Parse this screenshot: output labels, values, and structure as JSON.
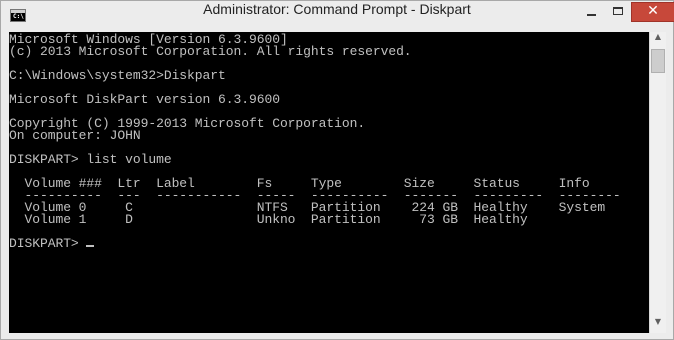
{
  "window": {
    "title": "Administrator: Command Prompt - Diskpart",
    "icon_label": "C:\\",
    "controls": {
      "minimize_icon": "minimize-icon",
      "maximize_icon": "maximize-icon",
      "close_glyph": "✕"
    }
  },
  "console": {
    "lines": [
      "Microsoft Windows [Version 6.3.9600]",
      "(c) 2013 Microsoft Corporation. All rights reserved.",
      "",
      "C:\\Windows\\system32>Diskpart",
      "",
      "Microsoft DiskPart version 6.3.9600",
      "",
      "Copyright (C) 1999-2013 Microsoft Corporation.",
      "On computer: JOHN",
      "",
      "DISKPART> list volume",
      "",
      "  Volume ###  Ltr  Label        Fs     Type        Size     Status     Info",
      "  ----------  ---  -----------  -----  ----------  -------  ---------  --------",
      "  Volume 0     C                NTFS   Partition    224 GB  Healthy    System",
      "  Volume 1     D                Unkno  Partition     73 GB  Healthy",
      ""
    ],
    "prompt": "DISKPART> "
  },
  "scrollbar": {
    "up_glyph": "▲",
    "down_glyph": "▼"
  },
  "colors": {
    "console_bg": "#000000",
    "console_text": "#c0c0c0",
    "close_button": "#c7483a"
  }
}
